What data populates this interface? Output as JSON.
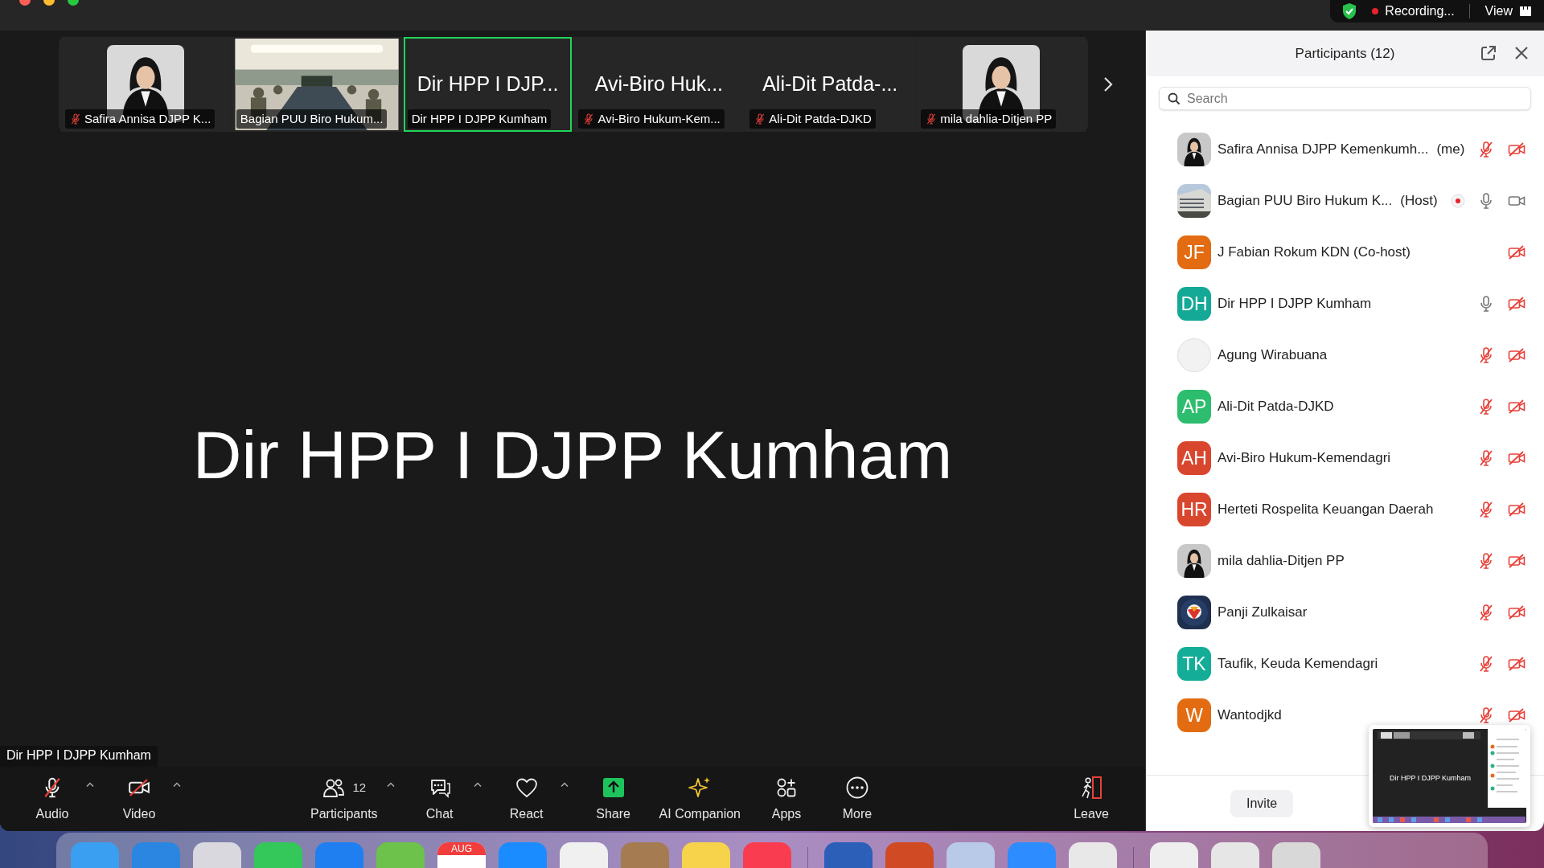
{
  "window": {
    "recording": "Recording...",
    "view": "View"
  },
  "gallery": {
    "tiles": [
      {
        "label": "Safira Annisa DJPP K...",
        "muted": true,
        "active": false
      },
      {
        "kind": "scene",
        "label": "Bagian PUU Biro Hukum...",
        "muted": false,
        "active": false
      },
      {
        "kind": "name",
        "display": "Dir HPP I DJP...",
        "label": "Dir HPP I DJPP Kumham",
        "muted": false,
        "active": true
      },
      {
        "kind": "name",
        "display": "Avi-Biro Huk...",
        "label": "Avi-Biro Hukum-Kem...",
        "muted": true,
        "active": false
      },
      {
        "kind": "name",
        "display": "Ali-Dit Patda-...",
        "label": "Ali-Dit Patda-DJKD",
        "muted": true,
        "active": false
      },
      {
        "label": "mila dahlia-Ditjen PP",
        "muted": true,
        "active": false
      }
    ]
  },
  "speaker": {
    "name": "Dir HPP I DJPP Kumham",
    "label": "Dir HPP I DJPP Kumham"
  },
  "toolbar": [
    {
      "label": "Audio",
      "kind": "audio",
      "caret": true
    },
    {
      "label": "Video",
      "kind": "video",
      "caret": true
    },
    {
      "label": "Participants",
      "kind": "participants",
      "count": "12",
      "caret": true
    },
    {
      "label": "Chat",
      "kind": "chat",
      "caret": true
    },
    {
      "label": "React",
      "kind": "react",
      "caret": true
    },
    {
      "label": "Share",
      "kind": "share",
      "caret": false
    },
    {
      "label": "AI Companion",
      "kind": "companion",
      "caret": false
    },
    {
      "label": "Apps",
      "kind": "apps",
      "caret": false
    },
    {
      "label": "More",
      "kind": "more",
      "caret": false
    },
    {
      "label": "Leave",
      "kind": "leave",
      "caret": false
    }
  ],
  "participants": {
    "title": "Participants (12)",
    "search": {
      "placeholder": "Search"
    },
    "items": [
      {
        "name": "Safira Annisa DJPP Kemenkumh...",
        "role": "(me)",
        "recording": false,
        "audio": true,
        "muted": true,
        "video_on": false
      },
      {
        "name": "Bagian PUU Biro Hukum K...",
        "role": "(Host)",
        "kind": "building",
        "recording": true,
        "audio": true,
        "muted": false,
        "video_on": true
      },
      {
        "name": "J Fabian Rokum KDN (Co-host)",
        "kind": "initials",
        "initials": "JF",
        "color": "#e36c12",
        "recording": false,
        "audio": false,
        "video_on": false
      },
      {
        "name": "Dir HPP I DJPP Kumham",
        "kind": "initials",
        "initials": "DH",
        "color": "#14a896",
        "recording": false,
        "audio": true,
        "muted": false,
        "video_on": false
      },
      {
        "name": "Agung Wirabuana",
        "kind": "blank",
        "recording": false,
        "audio": true,
        "muted": true,
        "video_on": false
      },
      {
        "name": "Ali-Dit Patda-DJKD",
        "kind": "initials",
        "initials": "AP",
        "color": "#2dbd6e",
        "recording": false,
        "audio": true,
        "muted": true,
        "video_on": false
      },
      {
        "name": "Avi-Biro Hukum-Kemendagri",
        "kind": "initials",
        "initials": "AH",
        "color": "#d9462e",
        "recording": false,
        "audio": true,
        "muted": true,
        "video_on": false
      },
      {
        "name": "Herteti Rospelita Keuangan Daerah",
        "kind": "initials",
        "initials": "HR",
        "color": "#d9462e",
        "recording": false,
        "audio": true,
        "muted": true,
        "video_on": false
      },
      {
        "name": "mila dahlia-Ditjen PP",
        "recording": false,
        "audio": true,
        "muted": true,
        "video_on": false
      },
      {
        "name": "Panji Zulkaisar",
        "kind": "emblem",
        "recording": false,
        "audio": true,
        "muted": true,
        "video_on": false
      },
      {
        "name": "Taufik, Keuda Kemendagri",
        "kind": "initials",
        "initials": "TK",
        "color": "#14ad97",
        "recording": false,
        "audio": true,
        "muted": true,
        "video_on": false
      },
      {
        "name": "Wantodjkd",
        "kind": "initials",
        "initials": "W",
        "color": "#e36c12",
        "recording": false,
        "audio": true,
        "muted": true,
        "video_on": false
      }
    ],
    "invite": "Invite"
  },
  "preview": {
    "caption": "Dir HPP I DJPP Kumham"
  },
  "dock": [
    {
      "kind": "app",
      "color": "#3a9ff0"
    },
    {
      "kind": "app",
      "color": "#2a86e0"
    },
    {
      "kind": "app",
      "color": "#d8d8de"
    },
    {
      "kind": "app",
      "color": "#34c759"
    },
    {
      "kind": "app",
      "color": "#1f7ff0"
    },
    {
      "kind": "app",
      "color": "#6cc24a"
    },
    {
      "kind": "calendar",
      "label": "AUG",
      "color": "#ffffff"
    },
    {
      "kind": "app",
      "color": "#1a8cff"
    },
    {
      "kind": "app",
      "color": "#f0f0f0"
    },
    {
      "kind": "app",
      "color": "#a57c52"
    },
    {
      "kind": "app",
      "color": "#f7d24b"
    },
    {
      "kind": "app",
      "color": "#fa3c50"
    },
    {
      "kind": "separator"
    },
    {
      "kind": "app",
      "color": "#2b5fb8"
    },
    {
      "kind": "app",
      "color": "#d04a23"
    },
    {
      "kind": "app",
      "color": "#b9c9e8"
    },
    {
      "kind": "app",
      "color": "#2d8cff"
    },
    {
      "kind": "app",
      "color": "#e8e8e8"
    },
    {
      "kind": "separator"
    },
    {
      "kind": "app",
      "color": "#eeeeee"
    },
    {
      "kind": "app",
      "color": "#e6e6e6"
    },
    {
      "kind": "app",
      "color": "#d8d8d8"
    }
  ]
}
